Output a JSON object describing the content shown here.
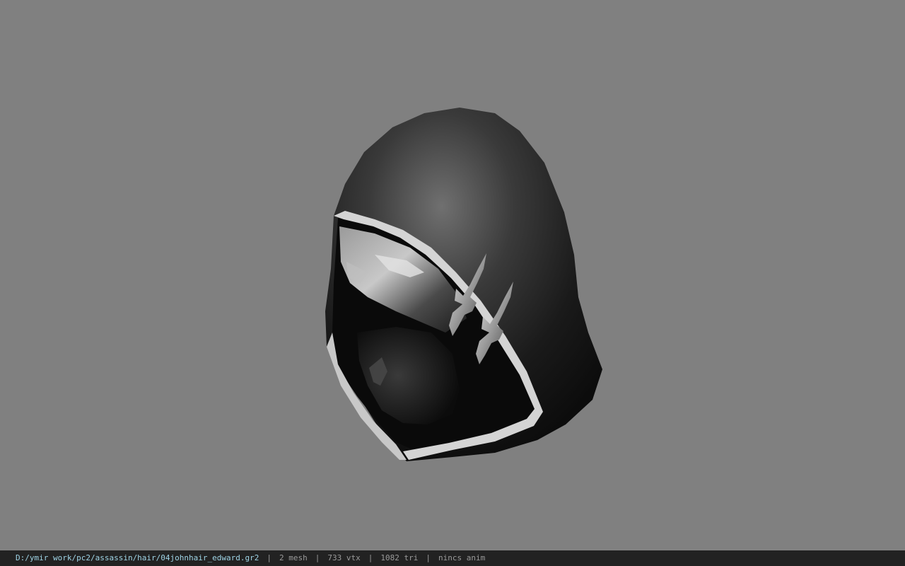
{
  "viewport": {
    "background_color": "#808080",
    "model": {
      "icon": "hooded-head-model"
    }
  },
  "status_bar": {
    "file_path": "D:/ymir work/pc2/assassin/hair/04johnhair_edward.gr2",
    "separator": "|",
    "mesh_count": "2 mesh",
    "vertex_count": "733 vtx",
    "triangle_count": "1082 tri",
    "animation": "nincs anim",
    "path_color": "#9fd4e6",
    "background_color": "#222222"
  }
}
